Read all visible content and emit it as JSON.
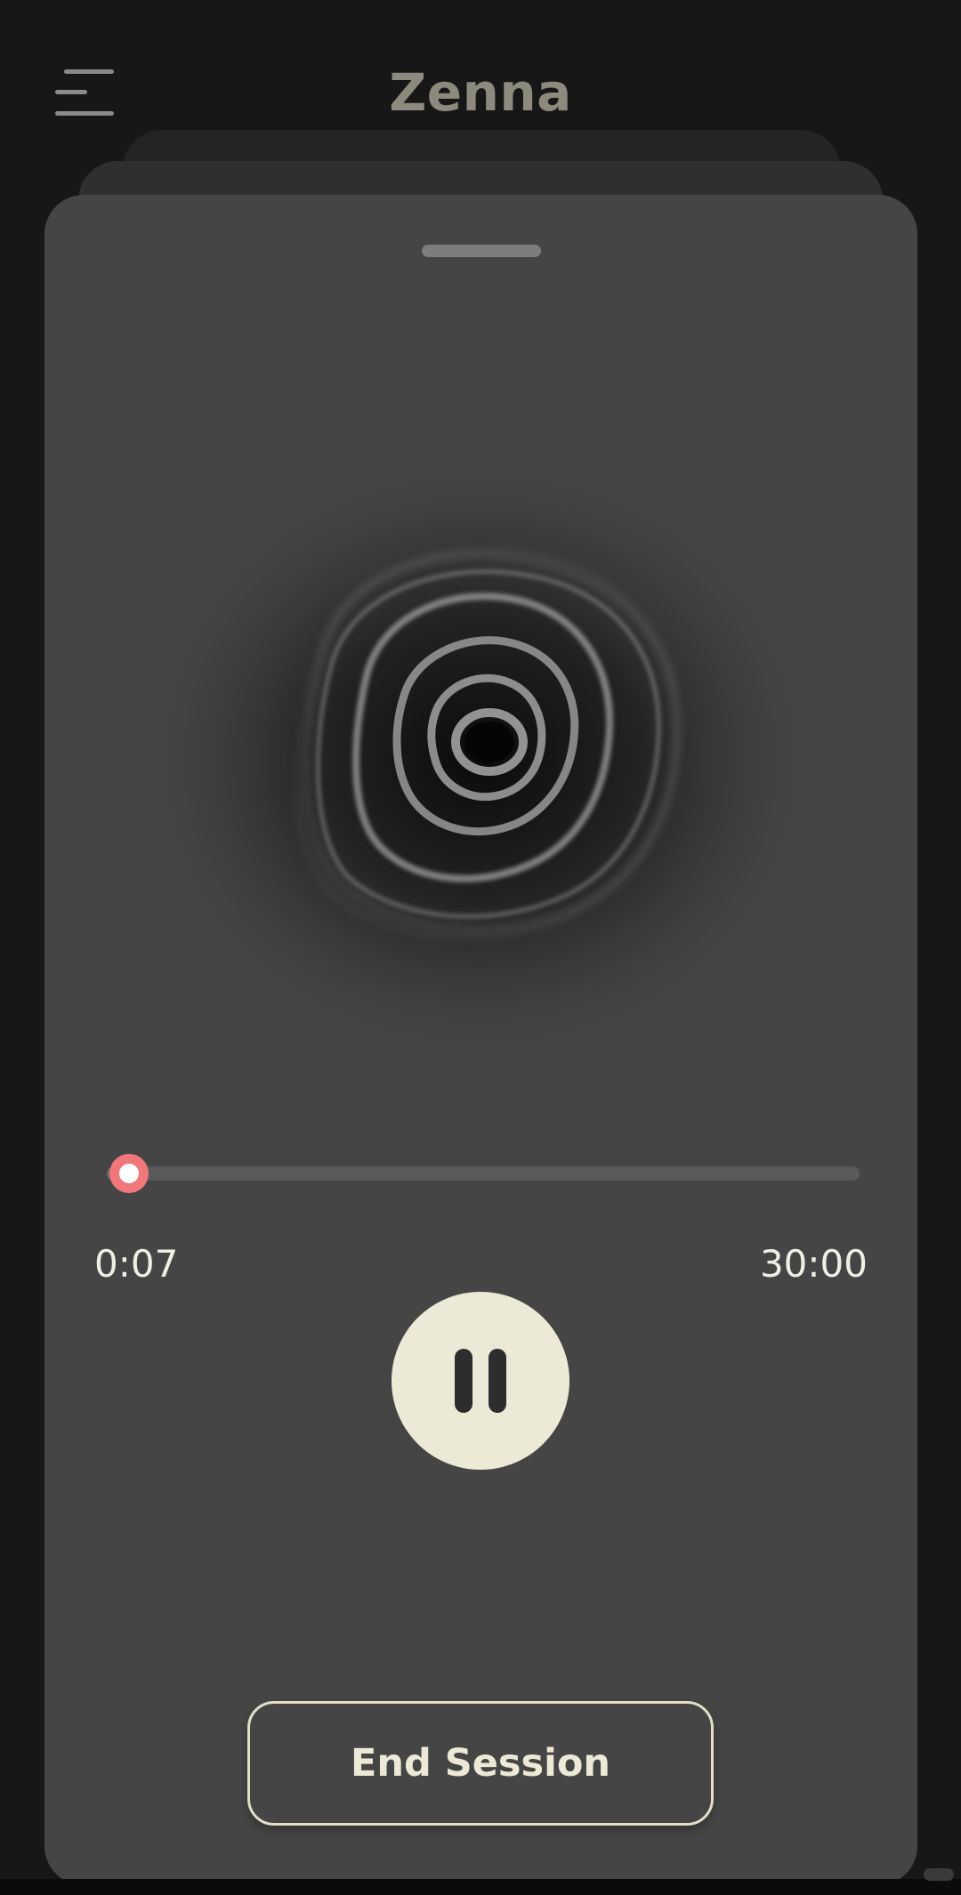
{
  "app": {
    "title": "Zenna"
  },
  "header": {
    "menu_icon": "hamburger-menu-icon"
  },
  "player": {
    "elapsed": "0:07",
    "total": "30:00",
    "progress_fraction": 0.004,
    "state": "playing",
    "pause_icon": "pause-icon",
    "end_session_label": "End Session"
  },
  "colors": {
    "background": "#171717",
    "card": "#454545",
    "accent_thumb": "#f0777a",
    "button_cream": "#ece9d6",
    "title_gray": "#8b8a7c"
  }
}
